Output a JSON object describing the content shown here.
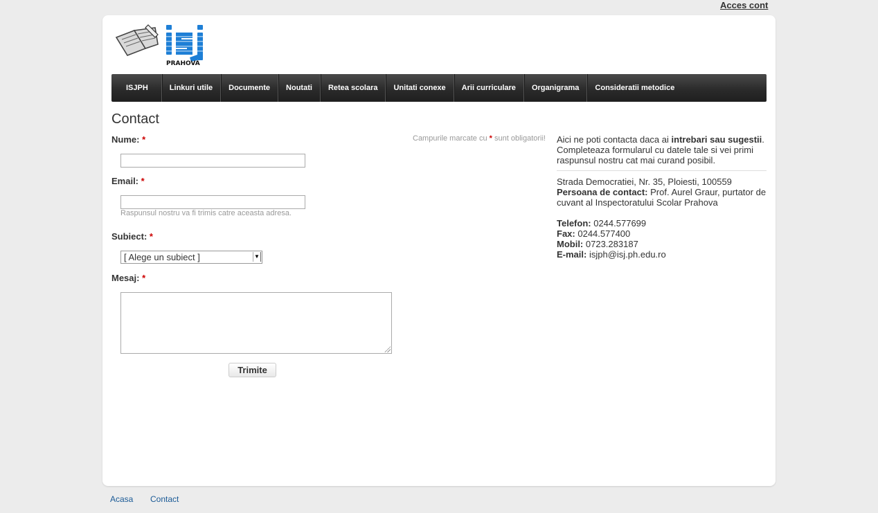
{
  "topbar": {
    "account_link": "Acces cont"
  },
  "logo": {
    "brand": "isj",
    "sub": "PRAHOVA"
  },
  "nav": {
    "items": [
      "ISJPH",
      "Linkuri utile",
      "Documente",
      "Noutati",
      "Retea scolara",
      "Unitati conexe",
      "Arii curriculare",
      "Organigrama",
      "Consideratii metodice"
    ]
  },
  "page": {
    "title": "Contact"
  },
  "form": {
    "required_note_prefix": "Campurile marcate cu",
    "required_note_star": "*",
    "required_note_suffix": "sunt obligatorii!",
    "name_label": "Nume:",
    "email_label": "Email:",
    "email_help": "Raspunsul nostru va fi trimis catre aceasta adresa.",
    "subject_label": "Subiect:",
    "subject_selected": "[ Alege un subiect ]",
    "message_label": "Mesaj:",
    "required_star": "*",
    "submit_label": "Trimite"
  },
  "sidebar": {
    "intro_prefix": "Aici ne poti contacta daca ai",
    "intro_bold": "intrebari sau sugestii",
    "intro_suffix": ". Completeaza formularul cu datele tale si vei primi raspunsul nostru cat mai curand posibil.",
    "address": "Strada Democratiei, Nr. 35, Ploiesti, 100559",
    "contact_person_label": "Persoana de contact:",
    "contact_person": "Prof. Aurel Graur, purtator de cuvant al Inspectoratului Scolar Prahova",
    "phone_label": "Telefon:",
    "phone": "0244.577699",
    "fax_label": "Fax:",
    "fax": "0244.577400",
    "mobile_label": "Mobil:",
    "mobile": "0723.283187",
    "email_label": "E-mail:",
    "email": "isjph@isj.ph.edu.ro"
  },
  "footer": {
    "links": [
      "Acasa",
      "Contact"
    ]
  },
  "colors": {
    "required": "#cc0000",
    "logo_blue": "#1e7fd6",
    "link": "#1a5a96"
  },
  "icons": {
    "logo": "book-pencil-icon"
  }
}
